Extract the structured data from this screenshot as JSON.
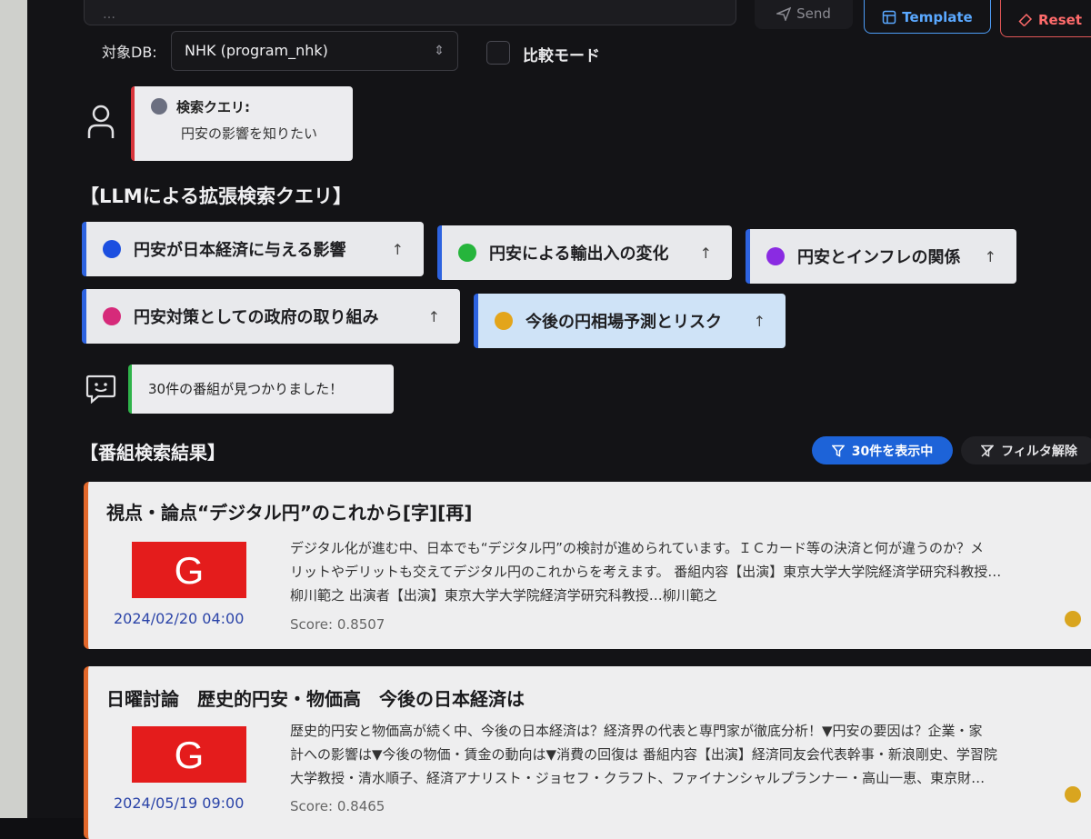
{
  "toolbar": {
    "search_placeholder": "…",
    "send_label": "Send",
    "template_label": "Template",
    "reset_label": "Reset"
  },
  "db": {
    "label": "対象DB:",
    "selected": "NHK (program_nhk)",
    "compare_label": "比較モード"
  },
  "user_query": {
    "title": "検索クエリ:",
    "text": "円安の影響を知りたい"
  },
  "llm_section": {
    "heading": "【LLMによる拡張検索クエリ】",
    "chips": [
      {
        "label": "円安が日本経済に与える影響",
        "color": "#1c4fe0"
      },
      {
        "label": "円安による輸出入の変化",
        "color": "#26b53c"
      },
      {
        "label": "円安とインフレの関係",
        "color": "#8a2be2"
      },
      {
        "label": "円安対策としての政府の取り組み",
        "color": "#d62a7a"
      },
      {
        "label": "今後の円相場予測とリスク",
        "color": "#e3a51b"
      }
    ]
  },
  "bot_message": "30件の番組が見つかりました！",
  "results": {
    "heading": "【番組検索結果】",
    "filter_badge": "30件を表示中",
    "filter_clear": "フィルタ解除",
    "items": [
      {
        "title": "視点・論点“デジタル円”のこれから[字][再]",
        "logo": "G",
        "date": "2024/02/20 04:00",
        "desc_lines": [
          "デジタル化が進む中、日本でも“デジタル円”の検討が進められています。ＩＣカード等の決済と何が違うのか？メ",
          "リットやデリットも交えてデジタル円のこれからを考えます。 番組内容【出演】東京大学大学院経済学研究科教授…",
          "柳川範之 出演者【出演】東京大学大学院経済学研究科教授…柳川範之"
        ],
        "score": "Score: 0.8507"
      },
      {
        "title": "日曜討論　歴史的円安・物価高　今後の日本経済は",
        "logo": "G",
        "date": "2024/05/19 09:00",
        "desc_lines": [
          "歴史的円安と物価高が続く中、今後の日本経済は？経済界の代表と専門家が徹底分析！▼円安の要因は？企業・家",
          "計への影響は▼今後の物価・賃金の動向は▼消費の回復は 番組内容【出演】経済同友会代表幹事・新浪剛史、学習院",
          "大学教授・清水順子、経済アナリスト・ジョセフ・クラフト、ファイナンシャルプランナー・高山一恵、東京財…"
        ],
        "score": "Score: 0.8465"
      }
    ]
  }
}
